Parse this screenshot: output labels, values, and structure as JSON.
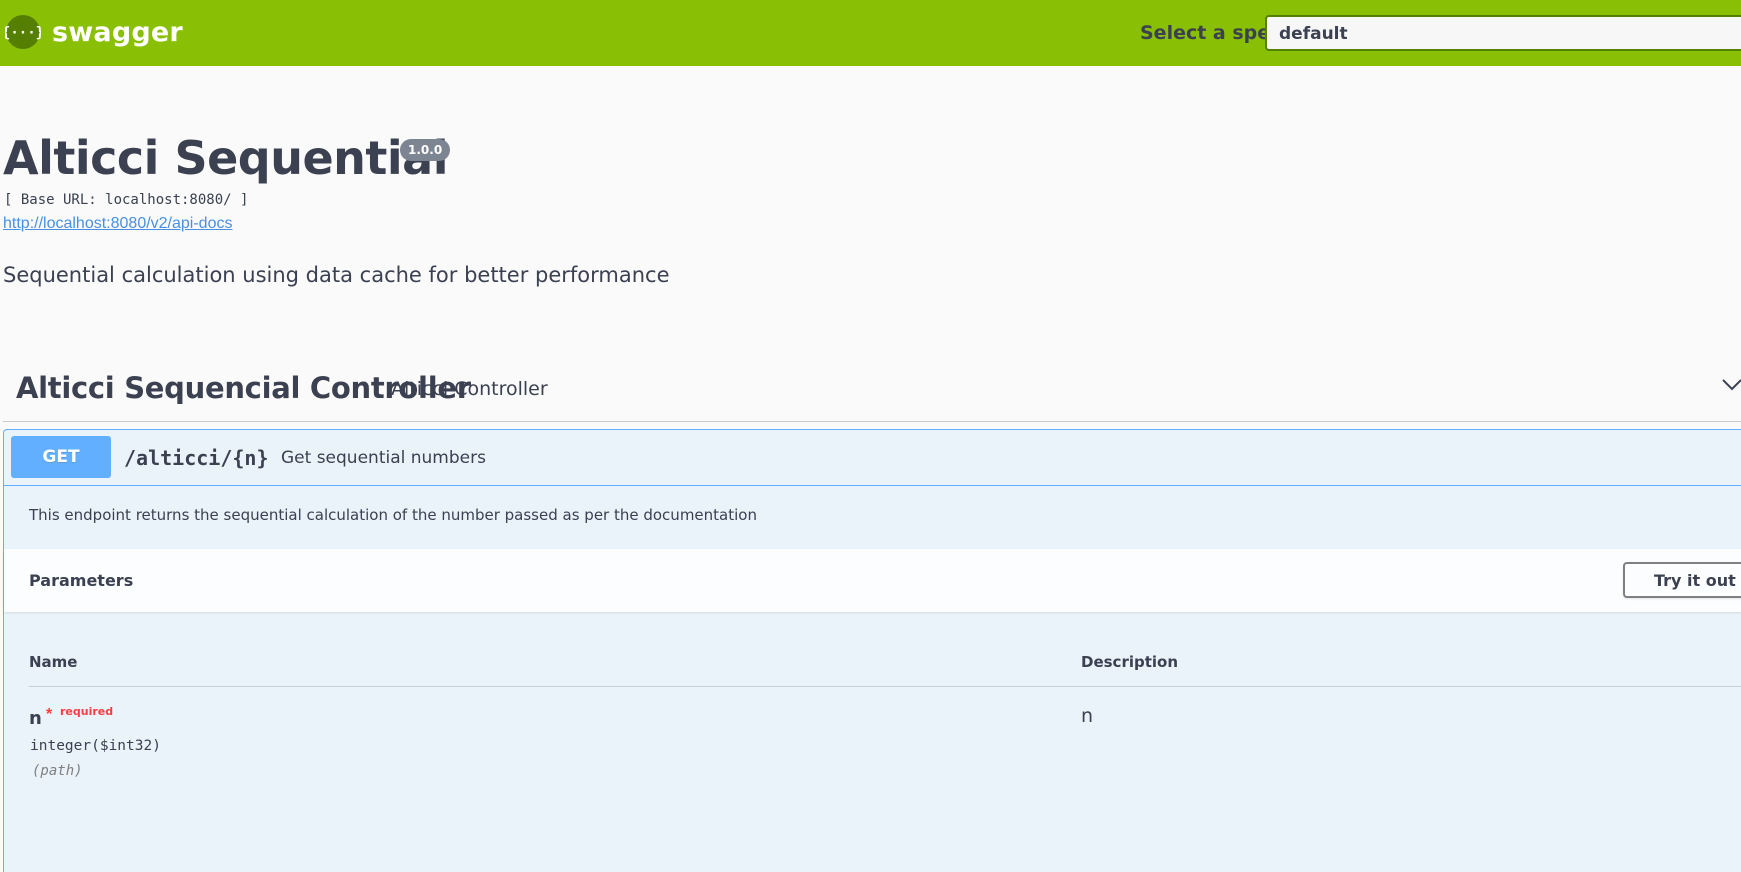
{
  "topbar": {
    "logo_text": "swagger",
    "spec_label": "Select a spec",
    "spec_value": "default",
    "colors": {
      "background": "#89bf04",
      "select_border": "#547f00"
    }
  },
  "info": {
    "title": "Alticci Sequential",
    "version": "1.0.0",
    "base_url": "[ Base URL: localhost:8080/ ]",
    "api_docs_link": "http://localhost:8080/v2/api-docs",
    "description": "Sequential calculation using data cache for better performance"
  },
  "tag": {
    "name": "Alticci Sequencial Controller",
    "description": "Alticci Controller",
    "chevron_icon": "chevron-down-icon"
  },
  "operation": {
    "method": "GET",
    "path": "/alticci/{n}",
    "summary": "Get sequential numbers",
    "description": "This endpoint returns the sequential calculation of the number passed as per the documentation",
    "colors": {
      "method": "#61affe"
    },
    "parameters_title": "Parameters",
    "try_it_out": "Try it out",
    "columns": {
      "name": "Name",
      "description": "Description"
    },
    "parameters": [
      {
        "name": "n",
        "star": "*",
        "required_label": "required",
        "type": "integer($int32)",
        "in": "(path)",
        "description": "n"
      }
    ]
  }
}
